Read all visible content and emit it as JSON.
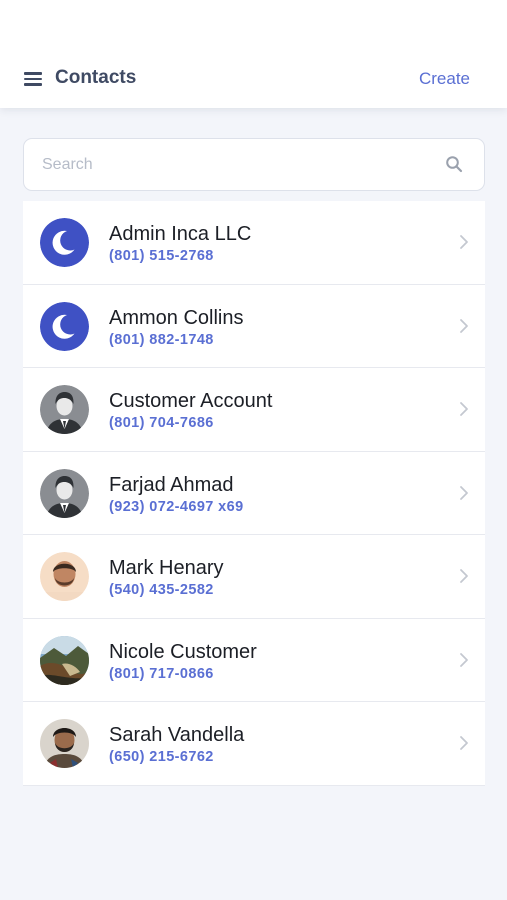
{
  "header": {
    "title": "Contacts",
    "create_label": "Create",
    "menu_icon": "hamburger-menu-icon"
  },
  "search": {
    "placeholder": "Search",
    "value": "",
    "icon": "search-icon"
  },
  "colors": {
    "accent": "#5a6fd3",
    "header_text": "#3f4a63",
    "background": "#f3f5fa",
    "moon_avatar_bg": "#3f51c4"
  },
  "contacts": [
    {
      "name": "Admin Inca LLC",
      "phone": "(801) 515-2768",
      "avatar": "moon-avatar-icon"
    },
    {
      "name": "Ammon Collins",
      "phone": "(801) 882-1748",
      "avatar": "moon-avatar-icon"
    },
    {
      "name": "Customer Account",
      "phone": "(801) 704-7686",
      "avatar": "default-person-avatar-icon"
    },
    {
      "name": "Farjad Ahmad",
      "phone": "(923) 072-4697 x69",
      "avatar": "default-person-avatar-icon"
    },
    {
      "name": "Mark Henary",
      "phone": "(540) 435-2582",
      "avatar": "photo-avatar"
    },
    {
      "name": "Nicole Customer",
      "phone": "(801) 717-0866",
      "avatar": "landscape-photo-avatar"
    },
    {
      "name": "Sarah Vandella",
      "phone": "(650) 215-6762",
      "avatar": "photo-avatar"
    }
  ]
}
